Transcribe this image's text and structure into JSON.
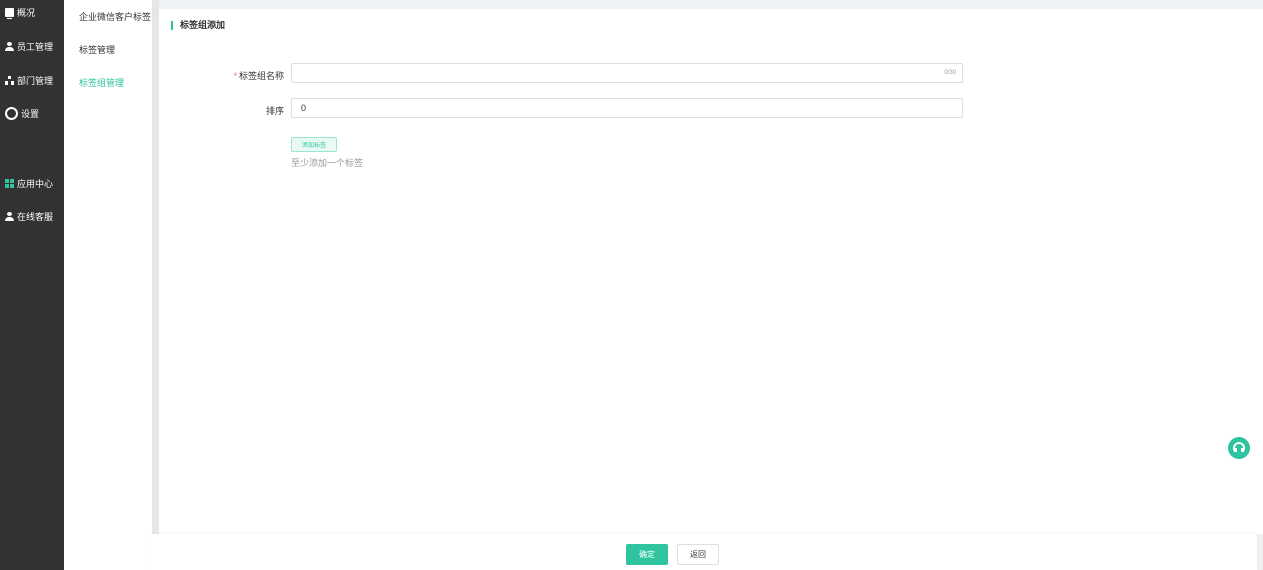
{
  "sidebar": {
    "items": [
      {
        "label": "概况",
        "icon": "monitor-icon"
      },
      {
        "label": "员工管理",
        "icon": "user-icon"
      },
      {
        "label": "部门管理",
        "icon": "org-icon"
      },
      {
        "label": "设置",
        "icon": "gear-icon"
      },
      {
        "label": "应用中心",
        "icon": "grid-icon"
      },
      {
        "label": "在线客服",
        "icon": "user-icon"
      }
    ]
  },
  "submenu": {
    "items": [
      {
        "label": "企业微信客户标签"
      },
      {
        "label": "标签管理"
      },
      {
        "label": "标签组管理",
        "active": true
      }
    ]
  },
  "main": {
    "title": "标签组添加",
    "form": {
      "name_label": "标签组名称",
      "name_required_mark": "*",
      "name_value": "",
      "name_counter": "0/30",
      "sort_label": "排序",
      "sort_value": "0",
      "add_tag_label": "添加标签",
      "hint": "至少添加一个标签"
    }
  },
  "footer": {
    "confirm_label": "确定",
    "back_label": "返回"
  },
  "colors": {
    "accent": "#2ec4a0",
    "sidebar_bg": "#323232",
    "required": "#f56c6c"
  }
}
